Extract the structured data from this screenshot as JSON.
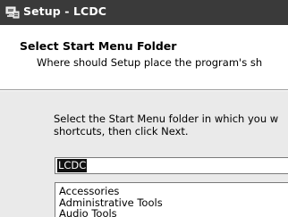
{
  "window": {
    "title": "Setup - LCDC",
    "icon": "setup-computer-icon"
  },
  "header": {
    "title": "Select Start Menu Folder",
    "subtitle": "Where should Setup place the program's sh"
  },
  "main": {
    "instruction_line1": "Select the Start Menu folder in which you w",
    "instruction_line2": "shortcuts, then click Next.",
    "folder_input_value": "LCDC",
    "folder_list": [
      "Accessories",
      "Administrative Tools",
      "Audio Tools"
    ]
  },
  "colors": {
    "titlebar": "#3a3a3a",
    "header_bg": "#ffffff",
    "body_bg": "#eaeaea",
    "selection": "#111111"
  }
}
